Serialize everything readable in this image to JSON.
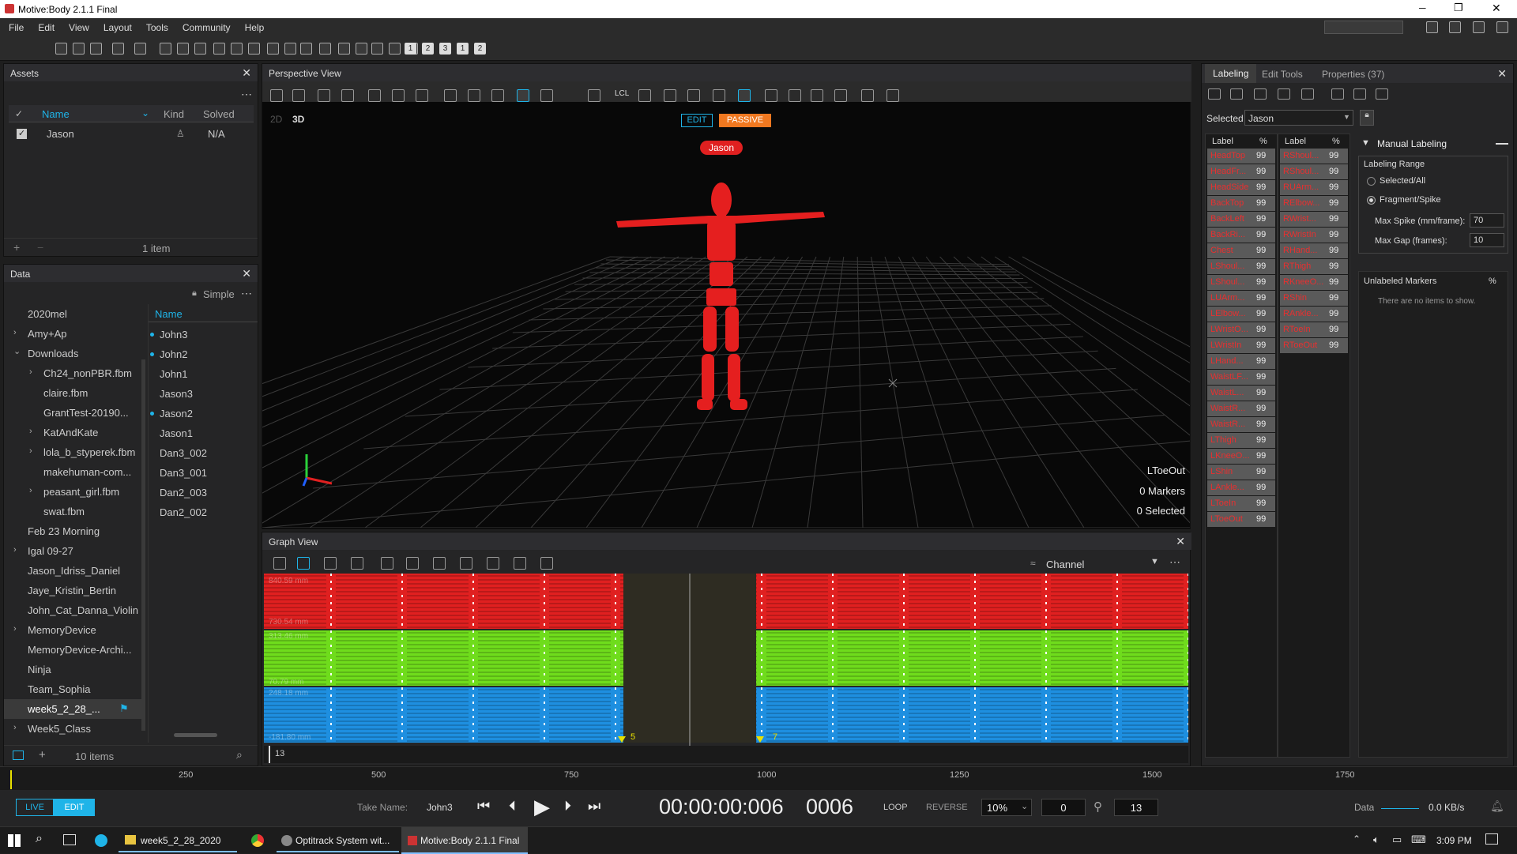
{
  "window": {
    "title": "Motive:Body 2.1.1 Final",
    "minimize": "─",
    "restore": "❐",
    "close": "✕"
  },
  "menu": [
    "File",
    "Edit",
    "View",
    "Layout",
    "Tools",
    "Community",
    "Help"
  ],
  "toolbar_numbers": [
    "1",
    "2",
    "3",
    "1",
    "2"
  ],
  "assets": {
    "title": "Assets",
    "columns": {
      "name": "Name",
      "kind": "Kind",
      "solved": "Solved"
    },
    "rows": [
      {
        "name": "Jason",
        "solved": "N/A"
      }
    ],
    "count": "1 item"
  },
  "data_panel": {
    "title": "Data",
    "mode": "Simple",
    "folders": [
      "2020mel",
      "Amy+Ap",
      "Downloads",
      "Ch24_nonPBR.fbm",
      "claire.fbm",
      "GrantTest-20190...",
      "KatAndKate",
      "lola_b_styperek.fbm",
      "makehuman-com...",
      "peasant_girl.fbm",
      "swat.fbm",
      "Feb 23 Morning",
      "Igal 09-27",
      "Jason_Idriss_Daniel",
      "Jaye_Kristin_Bertin",
      "John_Cat_Danna_Violin",
      "MemoryDevice",
      "MemoryDevice-Archi...",
      "Ninja",
      "Team_Sophia",
      "week5_2_28_...",
      "Week5_Class"
    ],
    "name_header": "Name",
    "takes": [
      "John3",
      "John2",
      "John1",
      "Jason3",
      "Jason2",
      "Jason1",
      "Dan3_002",
      "Dan3_001",
      "Dan2_003",
      "Dan2_002"
    ],
    "count": "10 items"
  },
  "perspective": {
    "title": "Perspective View",
    "mode_2d": "2D",
    "mode_3d": "3D",
    "edit": "EDIT",
    "passive": "PASSIVE",
    "asset_label": "Jason",
    "lcl": "LCL",
    "info": [
      "LToeOut",
      "0 Markers",
      "0 Selected"
    ]
  },
  "graph": {
    "title": "Graph View",
    "channel": "Channel",
    "y_labels": [
      "840.59 mm",
      "730.54 mm",
      "313.46 mm",
      "70.79 mm",
      "248.18 mm",
      "-181.80 mm"
    ],
    "gap_markers": [
      "5",
      "7"
    ],
    "frame": "13"
  },
  "labeling": {
    "tabs": [
      "Labeling",
      "Edit Tools",
      "Properties (37)"
    ],
    "selected_label": "Selected",
    "selected_value": "Jason",
    "col_label": "Label",
    "col_pct": "%",
    "left_labels": [
      "HeadTop",
      "HeadFr...",
      "HeadSide",
      "BackTop",
      "BackLeft",
      "BackRi...",
      "Chest",
      "LShoul...",
      "LShoul...",
      "LUArm...",
      "LElbow...",
      "LWristO...",
      "LWristIn",
      "LHand...",
      "WaistLF...",
      "WaistL...",
      "WaistR...",
      "WaistR...",
      "LThigh",
      "LKneeO...",
      "LShin",
      "LAnkle...",
      "LToeIn",
      "LToeOut"
    ],
    "right_labels": [
      "RShoul...",
      "RShoul...",
      "RUArm...",
      "RElbow...",
      "RWrist...",
      "RWristIn",
      "RHand...",
      "RThigh",
      "RKneeO...",
      "RShin",
      "RAnkle...",
      "RToeIn",
      "RToeOut"
    ],
    "pct": "99",
    "manual": "Manual Labeling",
    "range_title": "Labeling Range",
    "opt1": "Selected/All",
    "opt2": "Fragment/Spike",
    "max_spike_label": "Max Spike (mm/frame):",
    "max_spike_value": "70",
    "max_gap_label": "Max Gap (frames):",
    "max_gap_value": "10",
    "unlabeled": "Unlabeled Markers",
    "unlabeled_pct": "%",
    "no_items": "There are no items to show."
  },
  "timeline": {
    "ticks": [
      "250",
      "500",
      "750",
      "1000",
      "1250",
      "1500",
      "1750"
    ]
  },
  "transport": {
    "live": "LIVE",
    "edit": "EDIT",
    "take_label": "Take Name:",
    "take_value": "John3",
    "timecode": "00:00:00:006",
    "frame": "0006",
    "loop": "LOOP",
    "reverse": "REVERSE",
    "speed": "10%",
    "start": "0",
    "end": "13",
    "data_label": "Data",
    "rate": "0.0 KB/s"
  },
  "taskbar": {
    "items": [
      "week5_2_28_2020",
      "Optitrack System wit...",
      "Motive:Body 2.1.1 Final"
    ],
    "time": "3:09 PM"
  },
  "colors": {
    "accent": "#1fb4e8",
    "marker_red": "#e02020",
    "green": "#6fdc1c",
    "blue": "#1e8fe0",
    "passive": "#f07820"
  }
}
